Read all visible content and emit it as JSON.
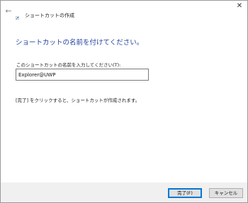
{
  "window": {
    "title": "ショートカットの作成",
    "back_icon": "back-arrow-icon",
    "close_glyph": "✕"
  },
  "main": {
    "heading": "ショートカットの名前を付けてください。",
    "name_label": "このショートカットの名前を入力してください(T):",
    "name_value": "Explorer@UWP",
    "hint": "[完了] をクリックすると、ショートカットが作成されます。"
  },
  "footer": {
    "finish_label": "完了(F)",
    "cancel_label": "キャンセル"
  },
  "colors": {
    "heading": "#1e3e9e",
    "primary_border": "#0078d7",
    "footer_bg": "#f0f0f0"
  }
}
